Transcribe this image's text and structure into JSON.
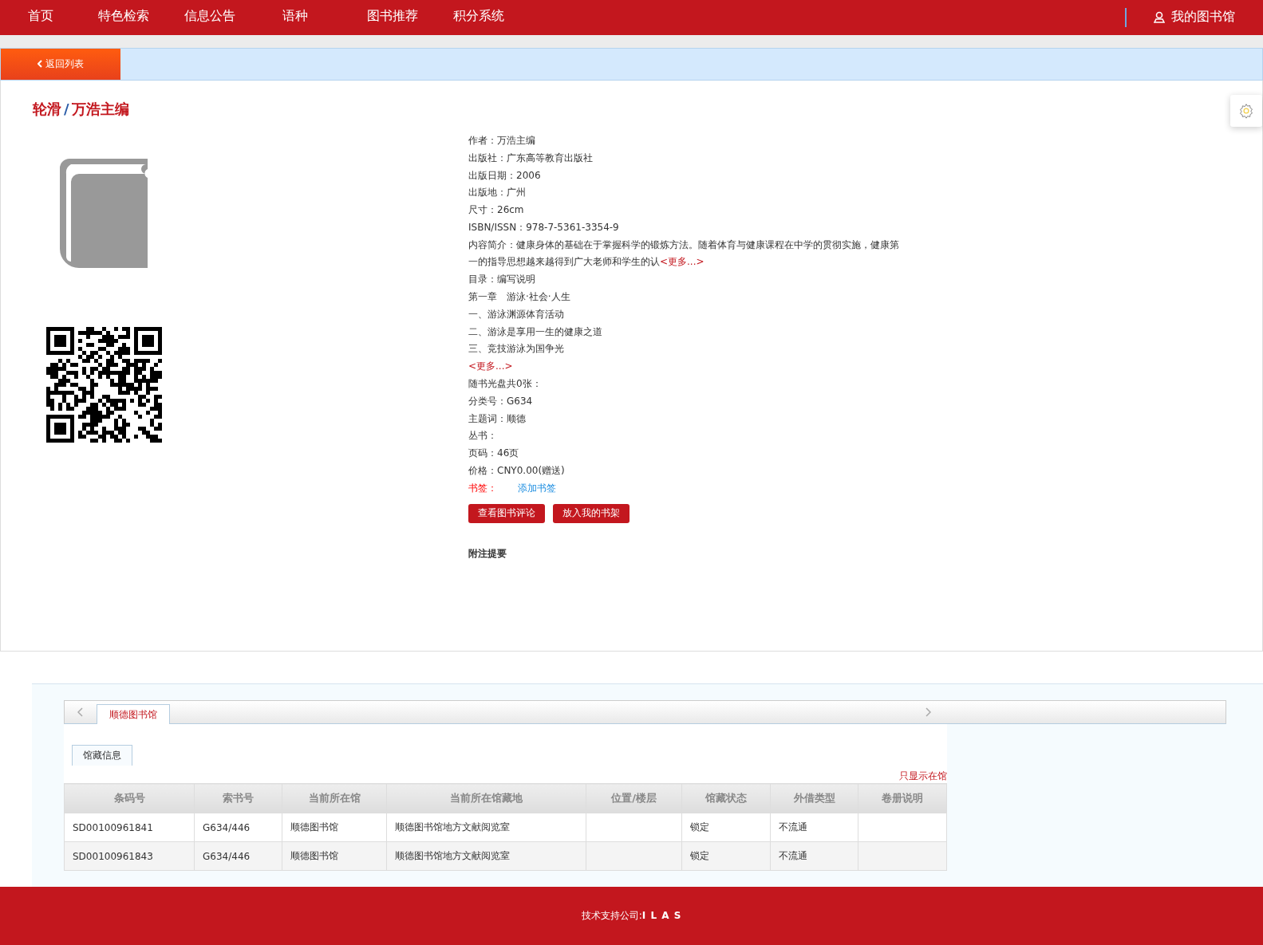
{
  "nav": {
    "items": [
      {
        "label": "首页",
        "selected": false
      },
      {
        "label": "特色检索",
        "selected": false
      },
      {
        "label": "信息公告",
        "selected": false
      },
      {
        "label": "语种",
        "selected": false
      },
      {
        "label": "图书推荐",
        "selected": false
      },
      {
        "label": "积分系统",
        "selected": false
      }
    ],
    "account": "我的图书馆"
  },
  "back_button": "返回列表",
  "title": {
    "name": "轮滑",
    "separator": "/",
    "author": "万浩主编"
  },
  "details": [
    {
      "kind": "field",
      "label": "作者：",
      "value": "万浩主编"
    },
    {
      "kind": "field",
      "label": "出版社：",
      "value": "广东高等教育出版社"
    },
    {
      "kind": "field",
      "label": "出版日期：",
      "value": "2006"
    },
    {
      "kind": "field",
      "label": "出版地：",
      "value": "广州"
    },
    {
      "kind": "field",
      "label": "尺寸：",
      "value": "26cm"
    },
    {
      "kind": "field",
      "label": "ISBN/ISSN：",
      "value": "978-7-5361-3354-9"
    },
    {
      "kind": "summary",
      "text": "内容简介：健康身体的基础在于掌握科学的锻炼方法。随着体育与健康课程在中学的贯彻实施，健康第一的指导思想越来越得到广大老师和学生的认",
      "more": "<更多...>"
    },
    {
      "kind": "field",
      "label": "目录：",
      "value": "编写说明"
    },
    {
      "kind": "line",
      "text": "第一章　游泳·社会·人生"
    },
    {
      "kind": "line",
      "text": "一、游泳渊源体育活动"
    },
    {
      "kind": "line",
      "text": "二、游泳是享用一生的健康之道"
    },
    {
      "kind": "line",
      "text": "三、竞技游泳为国争光"
    },
    {
      "kind": "more",
      "text": "<更多...>"
    },
    {
      "kind": "line",
      "text": "随书光盘共0张："
    },
    {
      "kind": "field",
      "label": "分类号：",
      "value": "G634"
    },
    {
      "kind": "field",
      "label": "主题词：",
      "value": "顺德"
    },
    {
      "kind": "line",
      "text": "丛书："
    },
    {
      "kind": "field",
      "label": "页码：",
      "value": "46页"
    },
    {
      "kind": "field",
      "label": "价格：",
      "value": "CNY0.00(赠送)"
    },
    {
      "kind": "bookmark",
      "label": "书签：",
      "link": "添加书签"
    }
  ],
  "actions": [
    "查看图书评论",
    "放入我的书架"
  ],
  "notes_heading": "附注提要",
  "holdings": {
    "library_tabs": [
      {
        "label": "顺德图书馆",
        "selected": true
      }
    ],
    "sub_tabs": [
      {
        "label": "馆藏信息",
        "selected": true
      }
    ],
    "filter_link": "只显示在馆",
    "columns": [
      "条码号",
      "索书号",
      "当前所在馆",
      "当前所在馆藏地",
      "位置/楼层",
      "馆藏状态",
      "外借类型",
      "卷册说明"
    ],
    "rows": [
      [
        "SD00100961841",
        "G634/446",
        "顺德图书馆",
        "顺德图书馆地方文献阅览室",
        null,
        "锁定",
        "不流通",
        null
      ],
      [
        "SD00100961843",
        "G634/446",
        "顺德图书馆",
        "顺德图书馆地方文献阅览室",
        null,
        "锁定",
        "不流通",
        null
      ]
    ]
  },
  "footer": {
    "label": "技术支持公司:",
    "company": "I L A S"
  }
}
